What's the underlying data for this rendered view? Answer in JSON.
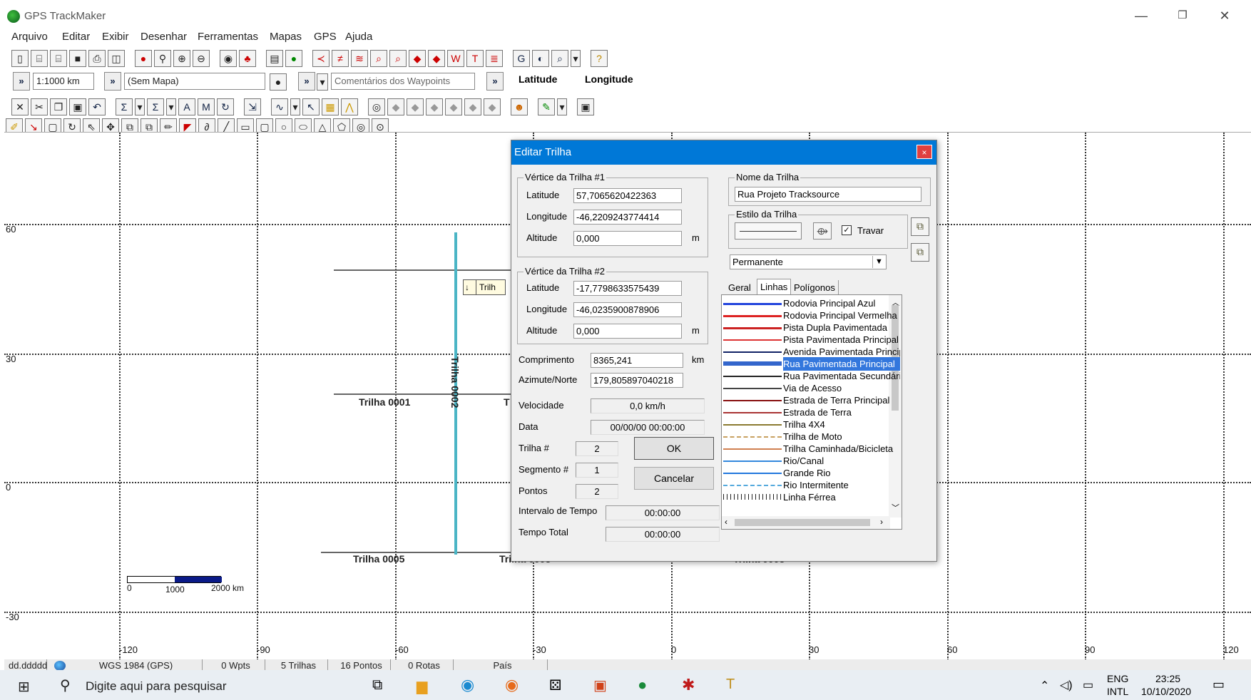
{
  "window": {
    "title": "GPS TrackMaker",
    "minimize": "—",
    "restore": "❐",
    "close": "✕"
  },
  "menu": [
    "Arquivo",
    "Editar",
    "Exibir",
    "Desenhar",
    "Ferramentas",
    "Mapas",
    "GPS",
    "Ajuda"
  ],
  "row2": {
    "scale": "1:1000 km",
    "map": "(Sem Mapa)",
    "comments": "Comentários dos Waypoints",
    "latitude": "Latitude",
    "longitude": "Longitude",
    "arrow": "»"
  },
  "axes": {
    "y": [
      "60",
      "30",
      "0",
      "-30"
    ],
    "x": [
      "-120",
      "-90",
      "-60",
      "-30",
      "0",
      "30",
      "60",
      "90",
      "120"
    ]
  },
  "trails": {
    "t1": "Trilha 0001",
    "t2": "Trilha 0002",
    "t5a": "Trilha 0005",
    "t5b": "Trilha 0005",
    "t5c": "Trilha 0005",
    "partial1": "T",
    "partial2": "Trilh",
    "partial3": "Trilha 0005"
  },
  "scalebar": {
    "l0": "0",
    "l1": "1000",
    "l2": "2000 km"
  },
  "status": {
    "format": "dd.ddddd",
    "datum": "WGS 1984 (GPS)",
    "wpts": "0 Wpts",
    "trilhas": "5 Trilhas",
    "pontos": "16 Pontos",
    "rotas": "0 Rotas",
    "pais": "País"
  },
  "taskbar": {
    "search": "Digite aqui para pesquisar",
    "lang1": "ENG",
    "lang2": "INTL",
    "time": "23:25",
    "date": "10/10/2020"
  },
  "dialog": {
    "title": "Editar Trilha",
    "close": "×",
    "v1": {
      "title": "Vértice da Trilha #1",
      "lat_label": "Latitude",
      "lat": "57,7065620422363",
      "lon_label": "Longitude",
      "lon": "-46,2209243774414",
      "alt_label": "Altitude",
      "alt": "0,000",
      "unit": "m"
    },
    "v2": {
      "title": "Vértice da Trilha #2",
      "lat_label": "Latitude",
      "lat": "-17,7798633575439",
      "lon_label": "Longitude",
      "lon": "-46,0235900878906",
      "alt_label": "Altitude",
      "alt": "0,000",
      "unit": "m"
    },
    "comprimento_label": "Comprimento",
    "comprimento": "8365,241",
    "km": "km",
    "azimute_label": "Azimute/Norte",
    "azimute": "179,805897040218",
    "velocidade_label": "Velocidade",
    "velocidade": "0,0 km/h",
    "data_label": "Data",
    "data": "00/00/00 00:00:00",
    "trilha_label": "Trilha #",
    "trilha": "2",
    "segmento_label": "Segmento #",
    "segmento": "1",
    "pontos_label": "Pontos",
    "pontos": "2",
    "intervalo_label": "Intervalo de Tempo",
    "intervalo": "00:00:00",
    "total_label": "Tempo Total",
    "total": "00:00:00",
    "ok": "OK",
    "cancel": "Cancelar",
    "nome_title": "Nome da Trilha",
    "nome": "Rua Projeto Tracksource",
    "estilo_title": "Estilo da Trilha",
    "travar": "Travar",
    "tipo": "Permanente",
    "tabs": [
      "Geral",
      "Linhas",
      "Polígonos"
    ],
    "lines": [
      {
        "name": "Rodovia Principal Azul",
        "color": "#2244dd"
      },
      {
        "name": "Rodovia Principal Vermelha",
        "color": "#dd2222"
      },
      {
        "name": "Pista Dupla Pavimentada",
        "color": "#cc2222"
      },
      {
        "name": "Pista Pavimentada Principal",
        "color": "#dd3333"
      },
      {
        "name": "Avenida Pavimentada Principal",
        "color": "#112266"
      },
      {
        "name": "Rua Pavimentada Principal",
        "color": "#3366cc"
      },
      {
        "name": "Rua Pavimentada Secundária",
        "color": "#222222"
      },
      {
        "name": "Via de Acesso",
        "color": "#444444"
      },
      {
        "name": "Estrada de Terra Principal",
        "color": "#881111"
      },
      {
        "name": "Estrada de Terra",
        "color": "#aa3333"
      },
      {
        "name": "Trilha 4X4",
        "color": "#8a7a30"
      },
      {
        "name": "Trilha de Moto",
        "color": "#c8a060"
      },
      {
        "name": "Trilha Caminhada/Bicicleta",
        "color": "#d08050"
      },
      {
        "name": "Rio/Canal",
        "color": "#3388dd"
      },
      {
        "name": "Grande Rio",
        "color": "#2277dd"
      },
      {
        "name": "Rio Intermitente",
        "color": "#55aadd"
      },
      {
        "name": "Linha Férrea",
        "color": "#222222"
      }
    ]
  }
}
